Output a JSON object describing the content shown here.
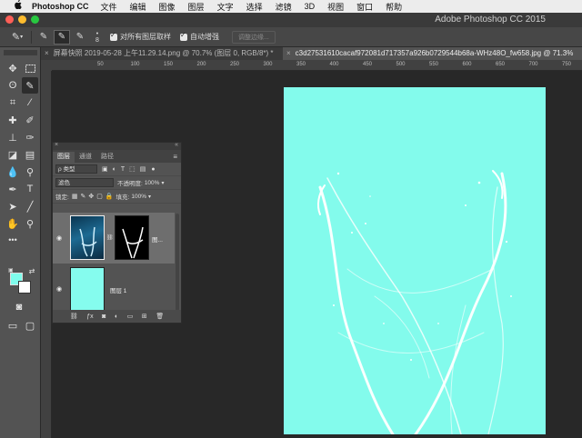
{
  "menubar": {
    "apple": "",
    "app": "Photoshop CC",
    "items": [
      "文件",
      "编辑",
      "图像",
      "图层",
      "文字",
      "选择",
      "滤镜",
      "3D",
      "视图",
      "窗口",
      "帮助"
    ]
  },
  "window": {
    "title": "Adobe Photoshop CC 2015"
  },
  "options": {
    "brush_size": "8",
    "sample_all_layers": "对所有图层取样",
    "auto_enhance": "自动增强",
    "refine_edge": "调整边缘..."
  },
  "tabs": [
    {
      "close": "×",
      "label": "屏幕快照 2019-05-28 上午11.29.14.png @ 70.7% (图层 0, RGB/8*) *"
    },
    {
      "close": "×",
      "label": "c3d27531610cacaf972081d717357a926b0729544b68a-WHz48O_fw658.jpg @ 71.3%"
    }
  ],
  "ruler": {
    "ticks": [
      "50",
      "100",
      "150",
      "200",
      "250",
      "300",
      "350",
      "400",
      "450",
      "500",
      "550",
      "600",
      "650",
      "700",
      "750"
    ]
  },
  "layers_panel": {
    "collapse": "«",
    "close": "×",
    "tabs": [
      "图层",
      "通道",
      "路径"
    ],
    "menu": "≡",
    "filter_kind": "ρ 类型",
    "blend_mode": "滤色",
    "opacity_label": "不透明度:",
    "opacity_value": "100%",
    "lock_label": "锁定:",
    "fill_label": "填充:",
    "fill_value": "100%",
    "layers": [
      {
        "name": "图...",
        "visible": true,
        "selected": true
      },
      {
        "name": "图层 1",
        "visible": true,
        "selected": false
      }
    ]
  },
  "colors": {
    "foreground": "#7ffcec",
    "background": "#ffffff",
    "canvas": "#83fbec"
  }
}
